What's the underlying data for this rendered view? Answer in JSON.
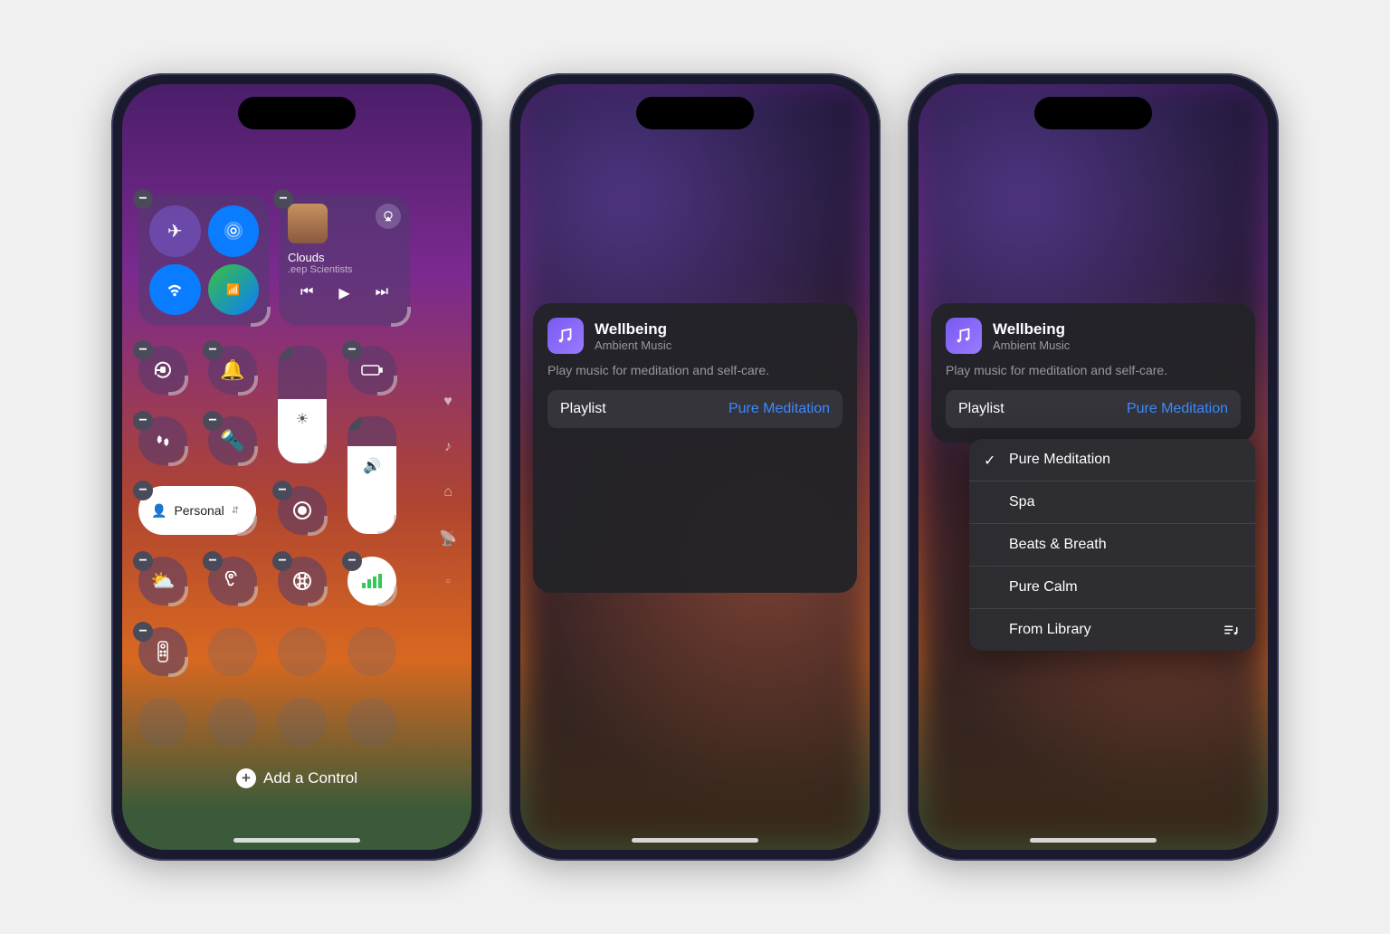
{
  "phone1": {
    "media": {
      "title": "Clouds",
      "artist": ".eep Scientists"
    },
    "focus": {
      "label": "Personal"
    },
    "add_control": "Add a Control"
  },
  "sheet": {
    "title": "Wellbeing",
    "subtitle": "Ambient Music",
    "description": "Play music for meditation and self-care.",
    "playlist_label": "Playlist",
    "playlist_value": "Pure Meditation"
  },
  "dropdown": {
    "items": [
      "Pure Meditation",
      "Spa",
      "Beats & Breath",
      "Pure Calm",
      "From Library"
    ],
    "selected": "Pure Meditation"
  }
}
